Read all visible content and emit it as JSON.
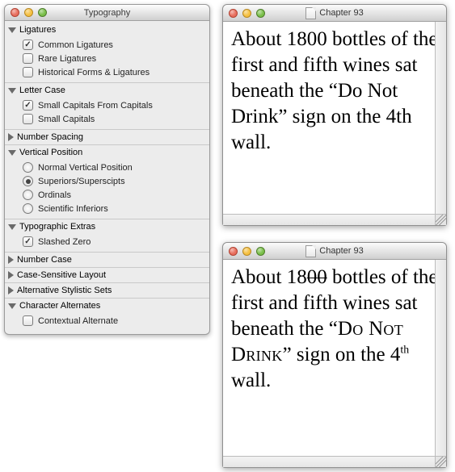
{
  "panel": {
    "title": "Typography",
    "sections": [
      {
        "label": "Ligatures",
        "open": true,
        "items": [
          {
            "kind": "check",
            "checked": true,
            "label": "Common Ligatures"
          },
          {
            "kind": "check",
            "checked": false,
            "label": "Rare Ligatures"
          },
          {
            "kind": "check",
            "checked": false,
            "label": "Historical Forms & Ligatures"
          }
        ]
      },
      {
        "label": "Letter Case",
        "open": true,
        "items": [
          {
            "kind": "check",
            "checked": true,
            "label": "Small Capitals From Capitals"
          },
          {
            "kind": "check",
            "checked": false,
            "label": "Small Capitals"
          }
        ]
      },
      {
        "label": "Number Spacing",
        "open": false,
        "items": []
      },
      {
        "label": "Vertical Position",
        "open": true,
        "items": [
          {
            "kind": "radio",
            "selected": false,
            "label": "Normal Vertical Position"
          },
          {
            "kind": "radio",
            "selected": true,
            "label": "Superiors/Superscipts"
          },
          {
            "kind": "radio",
            "selected": false,
            "label": "Ordinals"
          },
          {
            "kind": "radio",
            "selected": false,
            "label": "Scientific Inferiors"
          }
        ]
      },
      {
        "label": "Typographic Extras",
        "open": true,
        "items": [
          {
            "kind": "check",
            "checked": true,
            "label": "Slashed Zero"
          }
        ]
      },
      {
        "label": "Number Case",
        "open": false,
        "items": []
      },
      {
        "label": "Case-Sensitive Layout",
        "open": false,
        "items": []
      },
      {
        "label": "Alternative Stylistic Sets",
        "open": false,
        "items": []
      },
      {
        "label": "Character Alternates",
        "open": true,
        "items": [
          {
            "kind": "check",
            "checked": false,
            "label": "Contextual Alternate"
          }
        ]
      }
    ]
  },
  "document_top": {
    "title": "Chapter 93",
    "text": "About 1800 bottles of the first and fifth wines sat beneath the “Do Not Drink” sign on the 4th wall."
  },
  "document_bottom": {
    "title": "Chapter 93",
    "parts": {
      "p1": "About 18",
      "zero1": "0",
      "zero2": "0",
      "p2": " bottles of the first and fifth wines sat beneath the “",
      "sc1": "Do Not Drink",
      "p3": "” sign on the 4",
      "sup": "th",
      "p4": " wall."
    }
  }
}
